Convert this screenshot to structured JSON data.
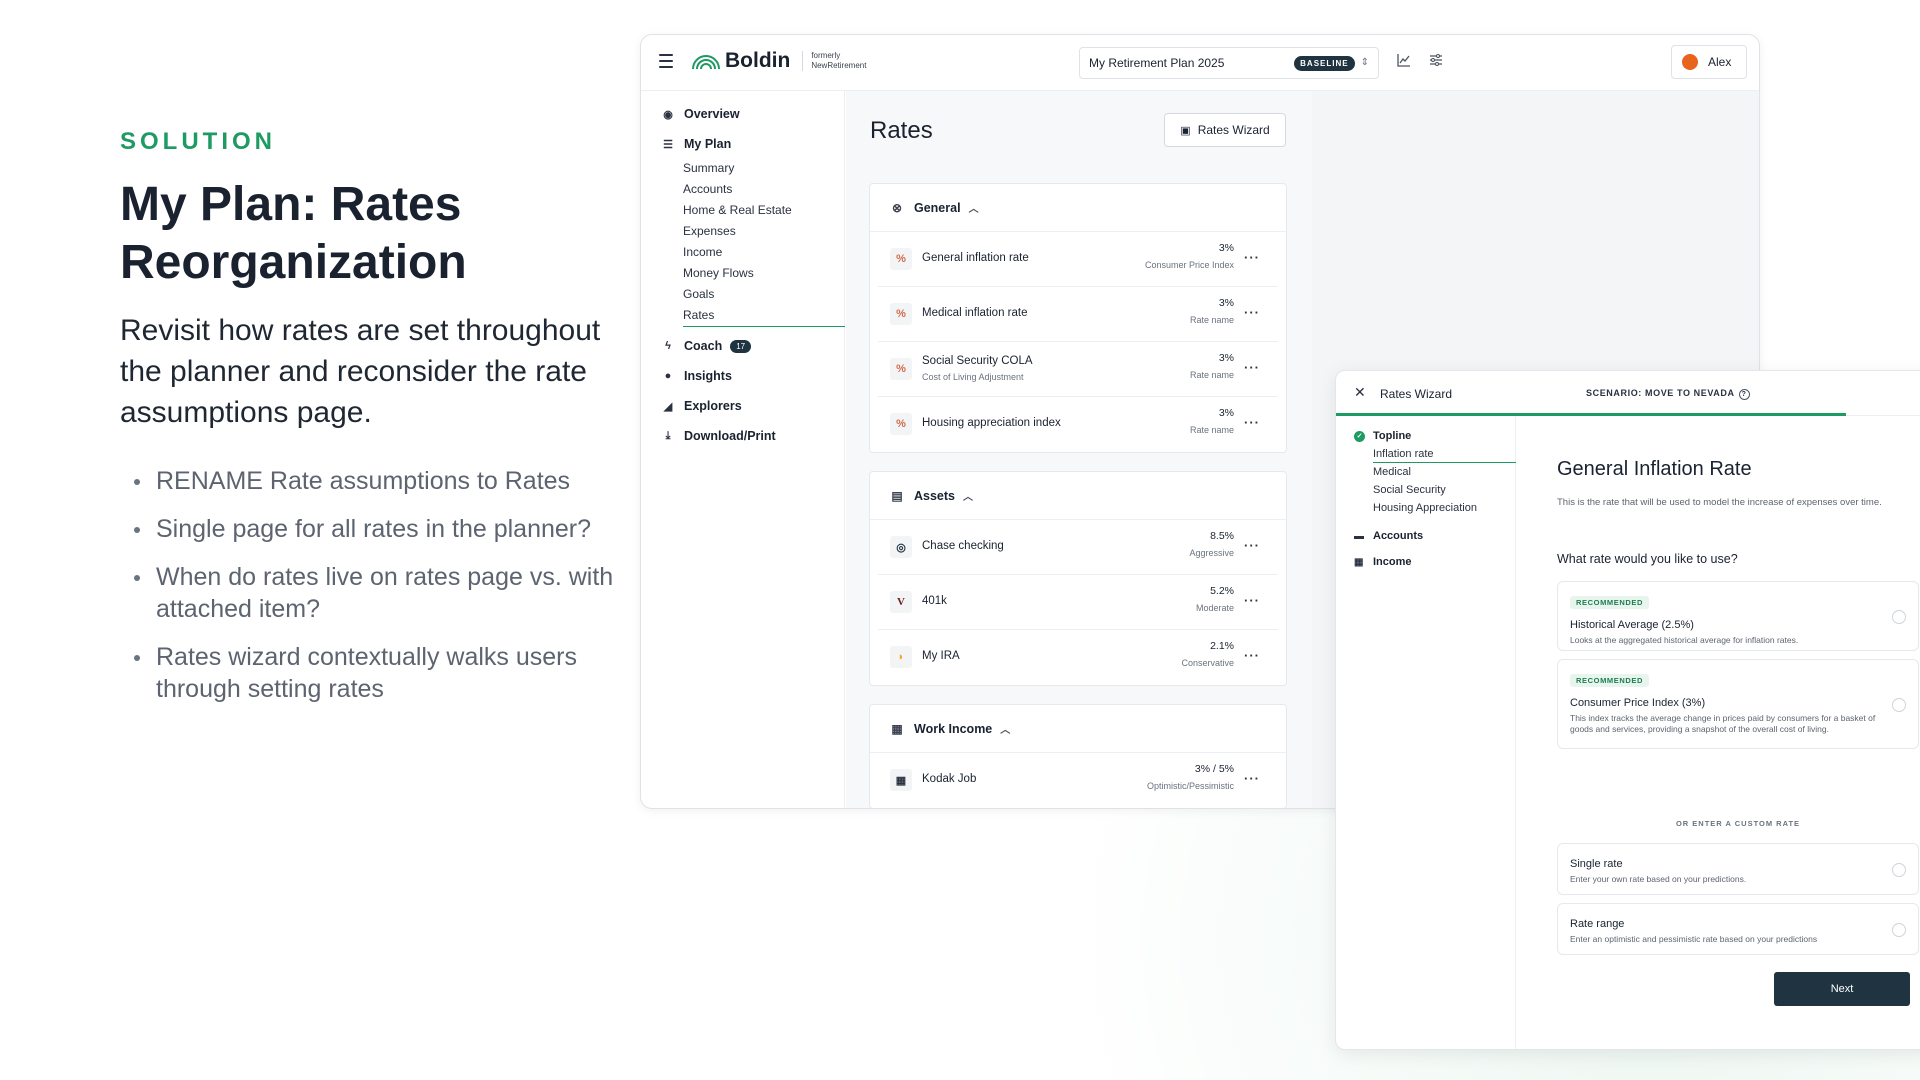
{
  "slide": {
    "eyebrow": "SOLUTION",
    "headline": "My Plan: Rates Reorganization",
    "lede": "Revisit how rates are set throughout the planner and reconsider the rate assumptions page.",
    "bullets": [
      "RENAME Rate assumptions to Rates",
      "Single page for all rates in the planner?",
      "When do rates live on rates page vs. with attached item?",
      "Rates wizard contextually walks users through setting rates"
    ]
  },
  "colors": {
    "brand_green": "#1e9a63",
    "dark_navy": "#1f3340",
    "avatar_orange": "#e8641c"
  },
  "topbar": {
    "logo": "Boldin",
    "formerly_line1": "formerly",
    "formerly_line2": "NewRetirement",
    "plan_name": "My Retirement Plan 2025",
    "plan_badge": "BASELINE",
    "user_name": "Alex",
    "icons": [
      "menu-icon",
      "chart-icon",
      "sliders-icon",
      "chevron-updown-icon"
    ]
  },
  "sidebar": {
    "main": [
      {
        "label": "Overview",
        "icon": "compass-icon"
      },
      {
        "label": "My Plan",
        "icon": "list-icon"
      },
      {
        "label": "Coach",
        "icon": "bolt-icon",
        "badge": "17"
      },
      {
        "label": "Insights",
        "icon": "bulb-icon"
      },
      {
        "label": "Explorers",
        "icon": "telescope-icon"
      },
      {
        "label": "Download/Print",
        "icon": "download-icon"
      }
    ],
    "plan_items": [
      "Summary",
      "Accounts",
      "Home & Real Estate",
      "Expenses",
      "Income",
      "Money Flows",
      "Goals",
      "Rates"
    ],
    "active_item": "Rates"
  },
  "rates_page": {
    "title": "Rates",
    "wizard_button": "Rates Wizard",
    "sections": [
      {
        "title": "General",
        "rows": [
          {
            "label": "General inflation rate",
            "sub": "",
            "value": "3%",
            "caption": "Consumer Price Index"
          },
          {
            "label": "Medical inflation rate",
            "sub": "",
            "value": "3%",
            "caption": "Rate name"
          },
          {
            "label": "Social Security COLA",
            "sub": "Cost of Living Adjustment",
            "value": "3%",
            "caption": "Rate name"
          },
          {
            "label": "Housing appreciation index",
            "sub": "",
            "value": "3%",
            "caption": "Rate name"
          }
        ]
      },
      {
        "title": "Assets",
        "rows": [
          {
            "label": "Chase checking",
            "sub": "",
            "value": "8.5%",
            "caption": "Aggressive"
          },
          {
            "label": "401k",
            "sub": "",
            "value": "5.2%",
            "caption": "Moderate"
          },
          {
            "label": "My IRA",
            "sub": "",
            "value": "2.1%",
            "caption": "Conservative"
          }
        ]
      },
      {
        "title": "Work Income",
        "rows": [
          {
            "label": "Kodak Job",
            "sub": "",
            "value": "3% / 5%",
            "caption": "Optimistic/Pessimistic"
          }
        ]
      }
    ]
  },
  "wizard": {
    "title": "Rates Wizard",
    "scenario": "SCENARIO: MOVE TO NEVADA",
    "steps": [
      {
        "label": "Topline",
        "subs": [
          "Inflation rate",
          "Medical",
          "Social Security",
          "Housing Appreciation"
        ]
      },
      {
        "label": "Accounts",
        "subs": []
      },
      {
        "label": "Income",
        "subs": []
      }
    ],
    "heading": "General Inflation Rate",
    "description": "This is the rate that will be used to model the increase of expenses over time.",
    "question": "What rate would you like to use?",
    "recommended_label": "RECOMMENDED",
    "options": [
      {
        "title": "Historical Average (2.5%)",
        "desc": "Looks at the aggregated historical average for inflation rates.",
        "recommended": true
      },
      {
        "title": "Consumer Price Index (3%)",
        "desc": "This index tracks the average change in prices paid by consumers for a basket of goods and services, providing a snapshot of the overall cost of living.",
        "recommended": true
      },
      {
        "title": "Single rate",
        "desc": "Enter your own rate based on your predictions.",
        "recommended": false
      },
      {
        "title": "Rate range",
        "desc": "Enter an optimistic and pessimistic rate based on your predictions",
        "recommended": false
      }
    ],
    "custom_divider": "OR ENTER A CUSTOM RATE",
    "next_button": "Next"
  }
}
